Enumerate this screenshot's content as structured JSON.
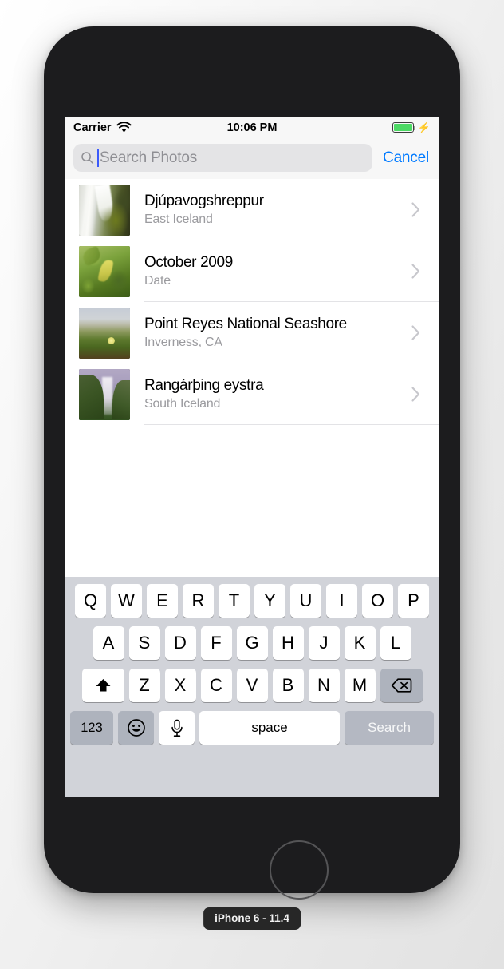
{
  "simulator": {
    "device_label": "iPhone 6 - 11.4"
  },
  "status_bar": {
    "carrier": "Carrier",
    "wifi_icon": "wifi-icon",
    "time": "10:06 PM",
    "battery_icon": "battery-full-icon",
    "charging_icon": "charging-bolt-icon",
    "battery_color": "#4cd964"
  },
  "search": {
    "icon": "search-icon",
    "placeholder": "Search Photos",
    "value": "",
    "cancel_label": "Cancel",
    "accent_color": "#007aff"
  },
  "results": [
    {
      "title": "Djúpavogshreppur",
      "subtitle": "East Iceland",
      "thumb": "waterfall-moss",
      "accessory": "chevron-right-icon"
    },
    {
      "title": "October 2009",
      "subtitle": "Date",
      "thumb": "green-leaves",
      "accessory": "chevron-right-icon"
    },
    {
      "title": "Point Reyes National Seashore",
      "subtitle": "Inverness, CA",
      "thumb": "coastal-dune",
      "accessory": "chevron-right-icon"
    },
    {
      "title": "Rangárþing eystra",
      "subtitle": "South Iceland",
      "thumb": "big-waterfall",
      "accessory": "chevron-right-icon"
    }
  ],
  "keyboard": {
    "row1": [
      "Q",
      "W",
      "E",
      "R",
      "T",
      "Y",
      "U",
      "I",
      "O",
      "P"
    ],
    "row2": [
      "A",
      "S",
      "D",
      "F",
      "G",
      "H",
      "J",
      "K",
      "L"
    ],
    "row3": [
      "Z",
      "X",
      "C",
      "V",
      "B",
      "N",
      "M"
    ],
    "shift_icon": "shift-up-arrow-icon",
    "delete_icon": "backspace-delete-icon",
    "numbers_label": "123",
    "emoji_icon": "emoji-smiley-icon",
    "dictation_icon": "microphone-icon",
    "space_label": "space",
    "return_label": "Search"
  }
}
